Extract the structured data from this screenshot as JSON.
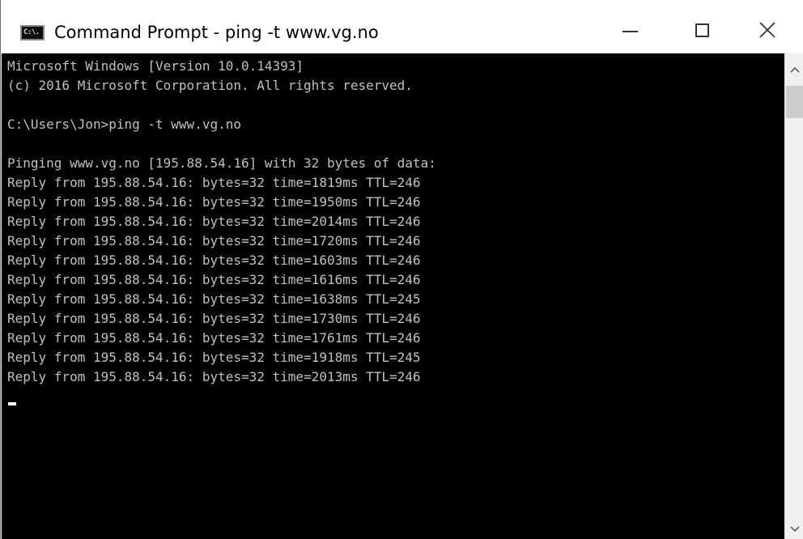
{
  "window": {
    "title": "Command Prompt - ping  -t www.vg.no",
    "icon_label": "C:\\."
  },
  "console": {
    "lines": [
      "Microsoft Windows [Version 10.0.14393]",
      "(c) 2016 Microsoft Corporation. All rights reserved.",
      "",
      "C:\\Users\\Jon>ping -t www.vg.no",
      "",
      "Pinging www.vg.no [195.88.54.16] with 32 bytes of data:",
      "Reply from 195.88.54.16: bytes=32 time=1819ms TTL=246",
      "Reply from 195.88.54.16: bytes=32 time=1950ms TTL=246",
      "Reply from 195.88.54.16: bytes=32 time=2014ms TTL=246",
      "Reply from 195.88.54.16: bytes=32 time=1720ms TTL=246",
      "Reply from 195.88.54.16: bytes=32 time=1603ms TTL=246",
      "Reply from 195.88.54.16: bytes=32 time=1616ms TTL=246",
      "Reply from 195.88.54.16: bytes=32 time=1638ms TTL=245",
      "Reply from 195.88.54.16: bytes=32 time=1730ms TTL=246",
      "Reply from 195.88.54.16: bytes=32 time=1761ms TTL=246",
      "Reply from 195.88.54.16: bytes=32 time=1918ms TTL=245",
      "Reply from 195.88.54.16: bytes=32 time=2013ms TTL=246"
    ]
  },
  "icons": {
    "app": "command-prompt-icon",
    "minimize": "minimize-icon",
    "maximize": "maximize-icon",
    "close": "close-icon",
    "scroll_up": "chevron-up-icon",
    "scroll_down": "chevron-down-icon"
  },
  "colors": {
    "console_background": "#000000",
    "console_text": "#c0c0c0",
    "titlebar_background": "#ffffff"
  }
}
